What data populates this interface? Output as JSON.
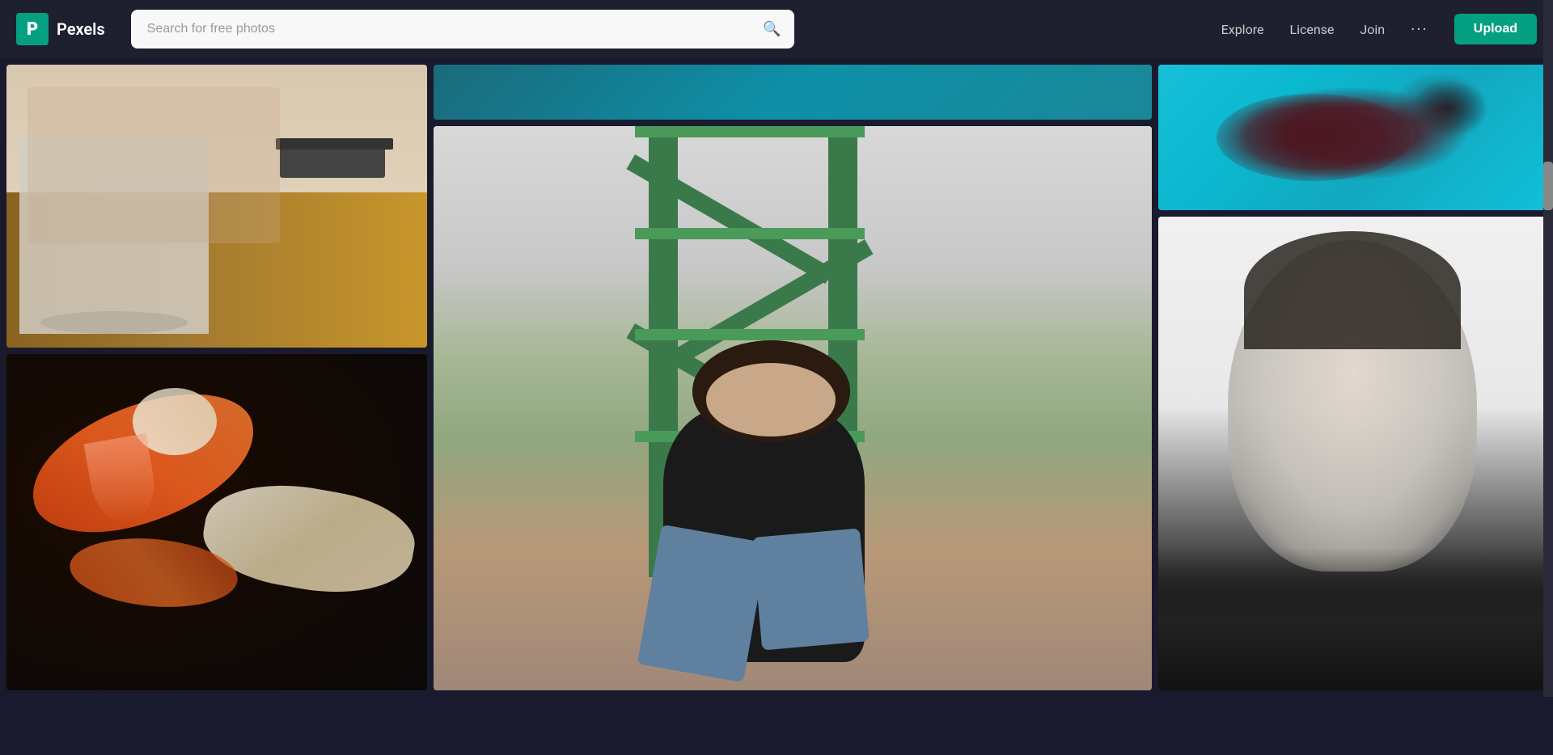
{
  "navbar": {
    "logo_letter": "P",
    "brand_name": "Pexels",
    "search_placeholder": "Search for free photos",
    "nav_links": [
      {
        "id": "explore",
        "label": "Explore"
      },
      {
        "id": "license",
        "label": "License"
      },
      {
        "id": "join",
        "label": "Join"
      }
    ],
    "more_label": "···",
    "upload_label": "Upload"
  },
  "photos": {
    "col1": [
      {
        "id": "office",
        "alt": "Office chair and wooden desk"
      },
      {
        "id": "koi",
        "alt": "Koi fish in dark water"
      }
    ],
    "col2": [
      {
        "id": "teal-bg",
        "alt": "Teal background"
      },
      {
        "id": "woman-scaffold",
        "alt": "Woman sitting on green scaffold"
      }
    ],
    "col3": [
      {
        "id": "underwater",
        "alt": "Underwater scene with blue water"
      },
      {
        "id": "man-portrait",
        "alt": "Young man smiling black and white portrait"
      }
    ]
  },
  "colors": {
    "nav_bg": "#1e2030",
    "logo_bg": "#05a081",
    "upload_bg": "#05a081",
    "accent": "#05a081"
  }
}
